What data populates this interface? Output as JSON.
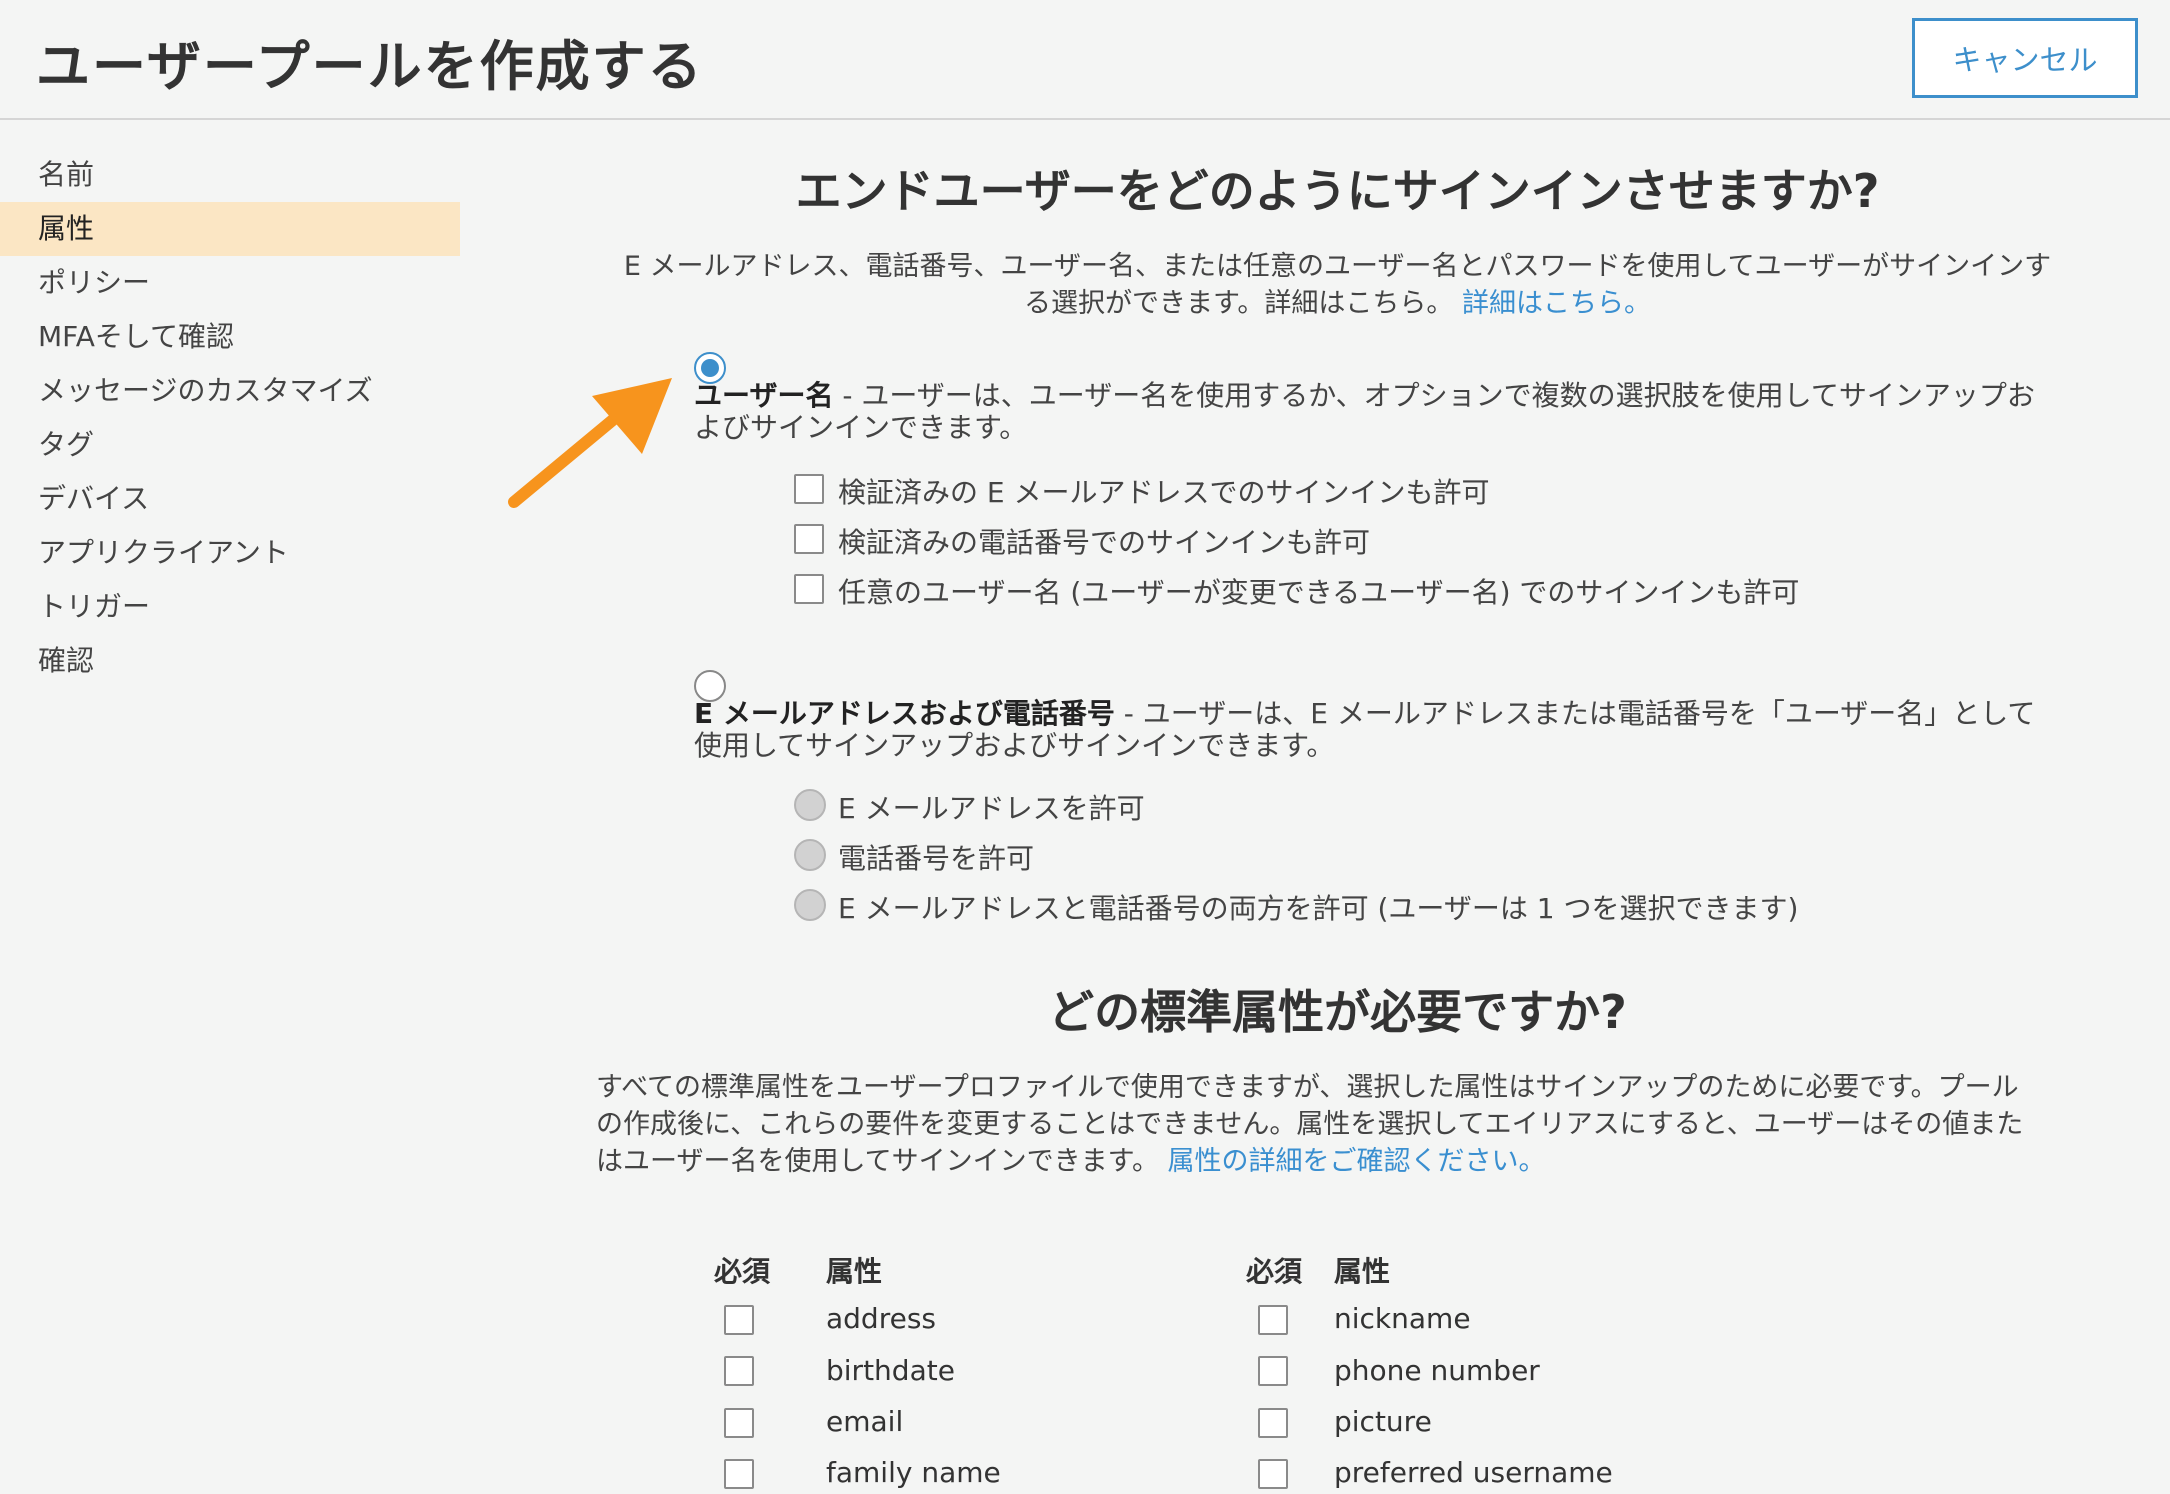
{
  "header": {
    "title": "ユーザープールを作成する",
    "cancel_label": "キャンセル"
  },
  "sidebar": {
    "items": [
      {
        "label": "名前",
        "active": false
      },
      {
        "label": "属性",
        "active": true
      },
      {
        "label": "ポリシー",
        "active": false
      },
      {
        "label": "MFAそして確認",
        "active": false
      },
      {
        "label": "メッセージのカスタマイズ",
        "active": false
      },
      {
        "label": "タグ",
        "active": false
      },
      {
        "label": "デバイス",
        "active": false
      },
      {
        "label": "アプリクライアント",
        "active": false
      },
      {
        "label": "トリガー",
        "active": false
      },
      {
        "label": "確認",
        "active": false
      }
    ]
  },
  "signin": {
    "heading": "エンドユーザーをどのようにサインインさせますか?",
    "desc_line1": "E メールアドレス、電話番号、ユーザー名、または任意のユーザー名とパスワードを使用してユーザーがサインインす",
    "desc_line2": "る選択ができます。詳細はこちら。",
    "desc_link": "詳細はこちら。",
    "username_option": {
      "title": "ユーザー名",
      "desc_line1": " - ユーザーは、ユーザー名を使用するか、オプションで複数の選択肢を使用してサインアップお",
      "desc_line2": "よびサインインできます。",
      "selected": true,
      "checkboxes": [
        "検証済みの E メールアドレスでのサインインも許可",
        "検証済みの電話番号でのサインインも許可",
        "任意のユーザー名 (ユーザーが変更できるユーザー名) でのサインインも許可"
      ]
    },
    "email_option": {
      "title": "E メールアドレスおよび電話番号",
      "desc_line1": " - ユーザーは、E メールアドレスまたは電話番号を「ユーザー名」として",
      "desc_line2": "使用してサインアップおよびサインインできます。",
      "selected": false,
      "radios": [
        "E メールアドレスを許可",
        "電話番号を許可",
        "E メールアドレスと電話番号の両方を許可 (ユーザーは 1 つを選択できます)"
      ]
    }
  },
  "attributes": {
    "heading": "どの標準属性が必要ですか?",
    "desc_line1": "すべての標準属性をユーザープロファイルで使用できますが、選択した属性はサインアップのために必要です。プール",
    "desc_line2": "の作成後に、これらの要件を変更することはできません。属性を選択してエイリアスにすると、ユーザーはその値また",
    "desc_line3": "はユーザー名を使用してサインインできます。",
    "desc_link": "属性の詳細をご確認ください。",
    "col_required": "必須",
    "col_attribute": "属性",
    "left": [
      "address",
      "birthdate",
      "email",
      "family name"
    ],
    "right": [
      "nickname",
      "phone number",
      "picture",
      "preferred username"
    ]
  },
  "colors": {
    "accent": "#3d8fcb",
    "sidebar_active": "#fbe6c4",
    "arrow": "#f7941d"
  },
  "annotation": {
    "icon": "arrow-icon"
  }
}
